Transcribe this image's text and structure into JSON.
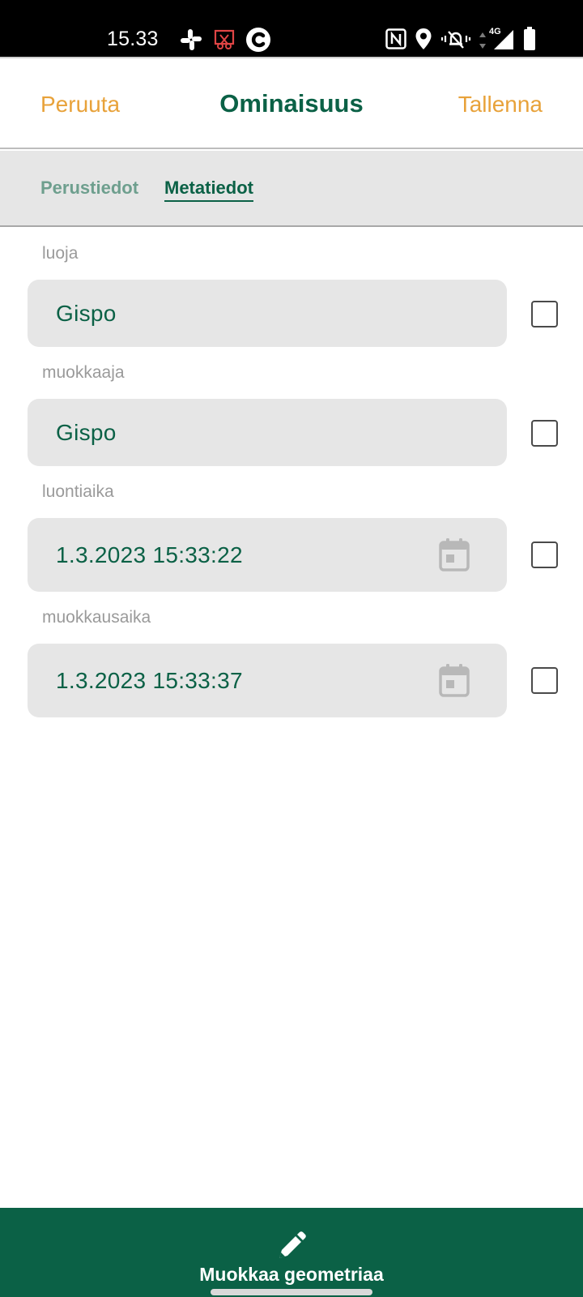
{
  "status_bar": {
    "time": "15.33",
    "left_icons": [
      "slack-icon",
      "screenshot-blocked-icon",
      "c-app-icon"
    ],
    "right_icons": [
      "nfc-icon",
      "location-icon",
      "vibrate-icon",
      "data-arrows-icon",
      "signal-4g-icon",
      "battery-icon"
    ],
    "network_label": "4G"
  },
  "header": {
    "cancel_label": "Peruuta",
    "title": "Ominaisuus",
    "save_label": "Tallenna"
  },
  "tabs": [
    {
      "label": "Perustiedot",
      "active": false
    },
    {
      "label": "Metatiedot",
      "active": true
    }
  ],
  "fields": [
    {
      "label": "luoja",
      "value": "Gispo",
      "type": "text",
      "checked": false
    },
    {
      "label": "muokkaaja",
      "value": "Gispo",
      "type": "text",
      "checked": false
    },
    {
      "label": "luontiaika",
      "value": "1.3.2023 15:33:22",
      "type": "datetime",
      "checked": false
    },
    {
      "label": "muokkausaika",
      "value": "1.3.2023 15:33:37",
      "type": "datetime",
      "checked": false
    }
  ],
  "bottom_bar": {
    "icon": "pencil-icon",
    "label": "Muokkaa geometriaa"
  },
  "colors": {
    "brand_green": "#0b6146",
    "accent_orange": "#e8a23a",
    "field_background": "#e6e6e6",
    "label_gray": "#9a9a9a"
  }
}
